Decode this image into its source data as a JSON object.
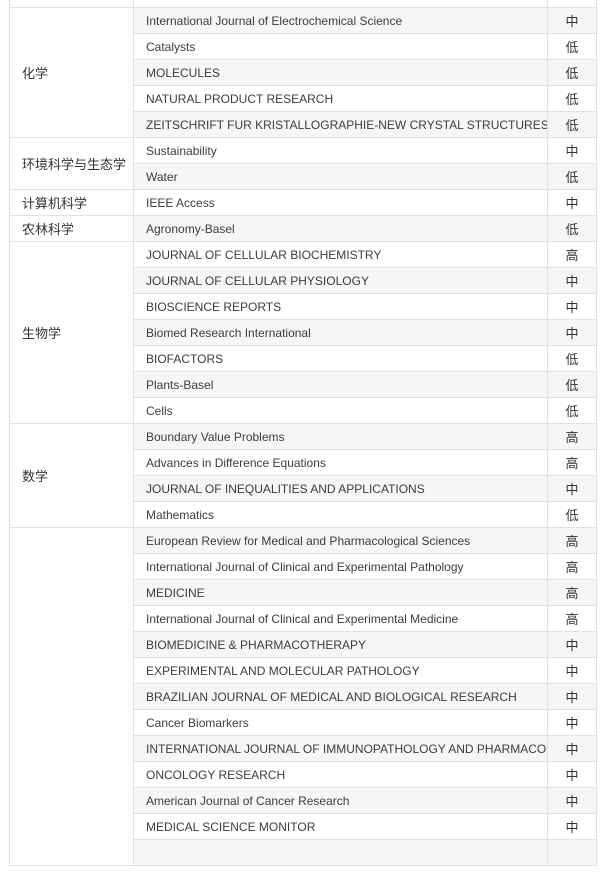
{
  "groups": [
    {
      "category": "",
      "rows": [
        {
          "journal": "",
          "level": ""
        }
      ]
    },
    {
      "category": "化学",
      "rows": [
        {
          "journal": "International Journal of Electrochemical Science",
          "level": "中"
        },
        {
          "journal": "Catalysts",
          "level": "低"
        },
        {
          "journal": "MOLECULES",
          "level": "低"
        },
        {
          "journal": "NATURAL PRODUCT RESEARCH",
          "level": "低"
        },
        {
          "journal": "ZEITSCHRIFT FUR KRISTALLOGRAPHIE-NEW CRYSTAL STRUCTURES",
          "level": "低"
        }
      ]
    },
    {
      "category": "环境科学与生态学",
      "rows": [
        {
          "journal": "Sustainability",
          "level": "中"
        },
        {
          "journal": "Water",
          "level": "低"
        }
      ]
    },
    {
      "category": "计算机科学",
      "rows": [
        {
          "journal": "IEEE Access",
          "level": "中"
        }
      ]
    },
    {
      "category": "农林科学",
      "rows": [
        {
          "journal": "Agronomy-Basel",
          "level": "低"
        }
      ]
    },
    {
      "category": "生物学",
      "rows": [
        {
          "journal": "JOURNAL OF CELLULAR BIOCHEMISTRY",
          "level": "高"
        },
        {
          "journal": "JOURNAL OF CELLULAR PHYSIOLOGY",
          "level": "中"
        },
        {
          "journal": "BIOSCIENCE REPORTS",
          "level": "中"
        },
        {
          "journal": "Biomed Research International",
          "level": "中"
        },
        {
          "journal": "BIOFACTORS",
          "level": "低"
        },
        {
          "journal": "Plants-Basel",
          "level": "低"
        },
        {
          "journal": "Cells",
          "level": "低"
        }
      ]
    },
    {
      "category": "数学",
      "rows": [
        {
          "journal": "Boundary Value Problems",
          "level": "高"
        },
        {
          "journal": "Advances in Difference Equations",
          "level": "高"
        },
        {
          "journal": "JOURNAL OF INEQUALITIES AND APPLICATIONS",
          "level": "中"
        },
        {
          "journal": "Mathematics",
          "level": "低"
        }
      ]
    },
    {
      "category": "",
      "rows": [
        {
          "journal": "European Review for Medical and Pharmacological Sciences",
          "level": "高"
        },
        {
          "journal": "International Journal of Clinical and Experimental Pathology",
          "level": "高"
        },
        {
          "journal": "MEDICINE",
          "level": "高"
        },
        {
          "journal": "International Journal of Clinical and Experimental Medicine",
          "level": "高"
        },
        {
          "journal": "BIOMEDICINE & PHARMACOTHERAPY",
          "level": "中"
        },
        {
          "journal": "EXPERIMENTAL AND MOLECULAR PATHOLOGY",
          "level": "中"
        },
        {
          "journal": "BRAZILIAN JOURNAL OF MEDICAL AND BIOLOGICAL RESEARCH",
          "level": "中"
        },
        {
          "journal": "Cancer Biomarkers",
          "level": "中"
        },
        {
          "journal": "INTERNATIONAL JOURNAL OF IMMUNOPATHOLOGY AND PHARMACOLOGY",
          "level": "中"
        },
        {
          "journal": "ONCOLOGY RESEARCH",
          "level": "中"
        },
        {
          "journal": "American Journal of Cancer Research",
          "level": "中"
        },
        {
          "journal": "MEDICAL SCIENCE MONITOR",
          "level": "中"
        },
        {
          "journal": "",
          "level": ""
        }
      ]
    }
  ]
}
